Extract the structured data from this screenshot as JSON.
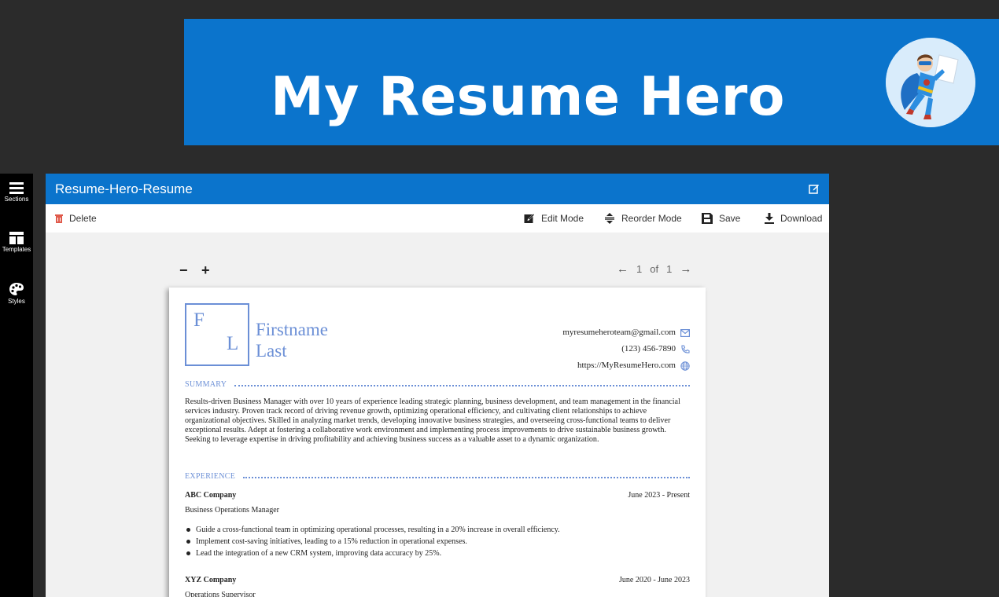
{
  "banner": {
    "title": "My Resume Hero"
  },
  "sidebar": {
    "items": [
      {
        "label": "Sections",
        "icon": "hamburger-icon"
      },
      {
        "label": "Templates",
        "icon": "layout-icon"
      },
      {
        "label": "Styles",
        "icon": "palette-icon"
      }
    ]
  },
  "app": {
    "doc_title": "Resume-Hero-Resume",
    "toolbar": {
      "delete": "Delete",
      "edit_mode": "Edit Mode",
      "reorder_mode": "Reorder Mode",
      "save": "Save",
      "download": "Download"
    },
    "zoom": {
      "minus": "−",
      "plus": "+"
    },
    "pager": {
      "prev": "←",
      "current": "1",
      "of": "of",
      "total": "1",
      "next": "→"
    }
  },
  "resume": {
    "initials": {
      "first": "F",
      "last": "L"
    },
    "first_name": "Firstname",
    "last_name": "Last",
    "email": "myresumeheroteam@gmail.com",
    "phone": "(123) 456-7890",
    "website": "https://MyResumeHero.com",
    "summary_heading": "SUMMARY",
    "summary": "Results-driven Business Manager with over 10 years of experience leading strategic planning, business development, and team management in the financial services industry. Proven track record of driving revenue growth, optimizing operational efficiency, and cultivating client relationships to achieve organizational objectives. Skilled in analyzing market trends, developing innovative business strategies, and overseeing cross-functional teams to deliver exceptional results. Adept at fostering a collaborative work environment and implementing process improvements to drive sustainable business growth. Seeking to leverage expertise in driving profitability and achieving business success as a valuable asset to a dynamic organization.",
    "experience_heading": "EXPERIENCE",
    "jobs": [
      {
        "company": "ABC Company",
        "dates": "June 2023 - Present",
        "title": "Business Operations Manager",
        "bullets": [
          "Guide a cross-functional team in optimizing operational processes, resulting in a 20% increase in overall efficiency.",
          "Implement cost-saving initiatives, leading to a 15% reduction in operational expenses.",
          "Lead the integration of a new CRM system, improving data accuracy by 25%."
        ]
      },
      {
        "company": "XYZ Company",
        "dates": "June 2020 - June 2023",
        "title": "Operations Supervisor"
      }
    ]
  },
  "colors": {
    "brand_blue": "#0b74cc",
    "accent": "#6b8fd6",
    "delete_red": "#e05a4b"
  }
}
